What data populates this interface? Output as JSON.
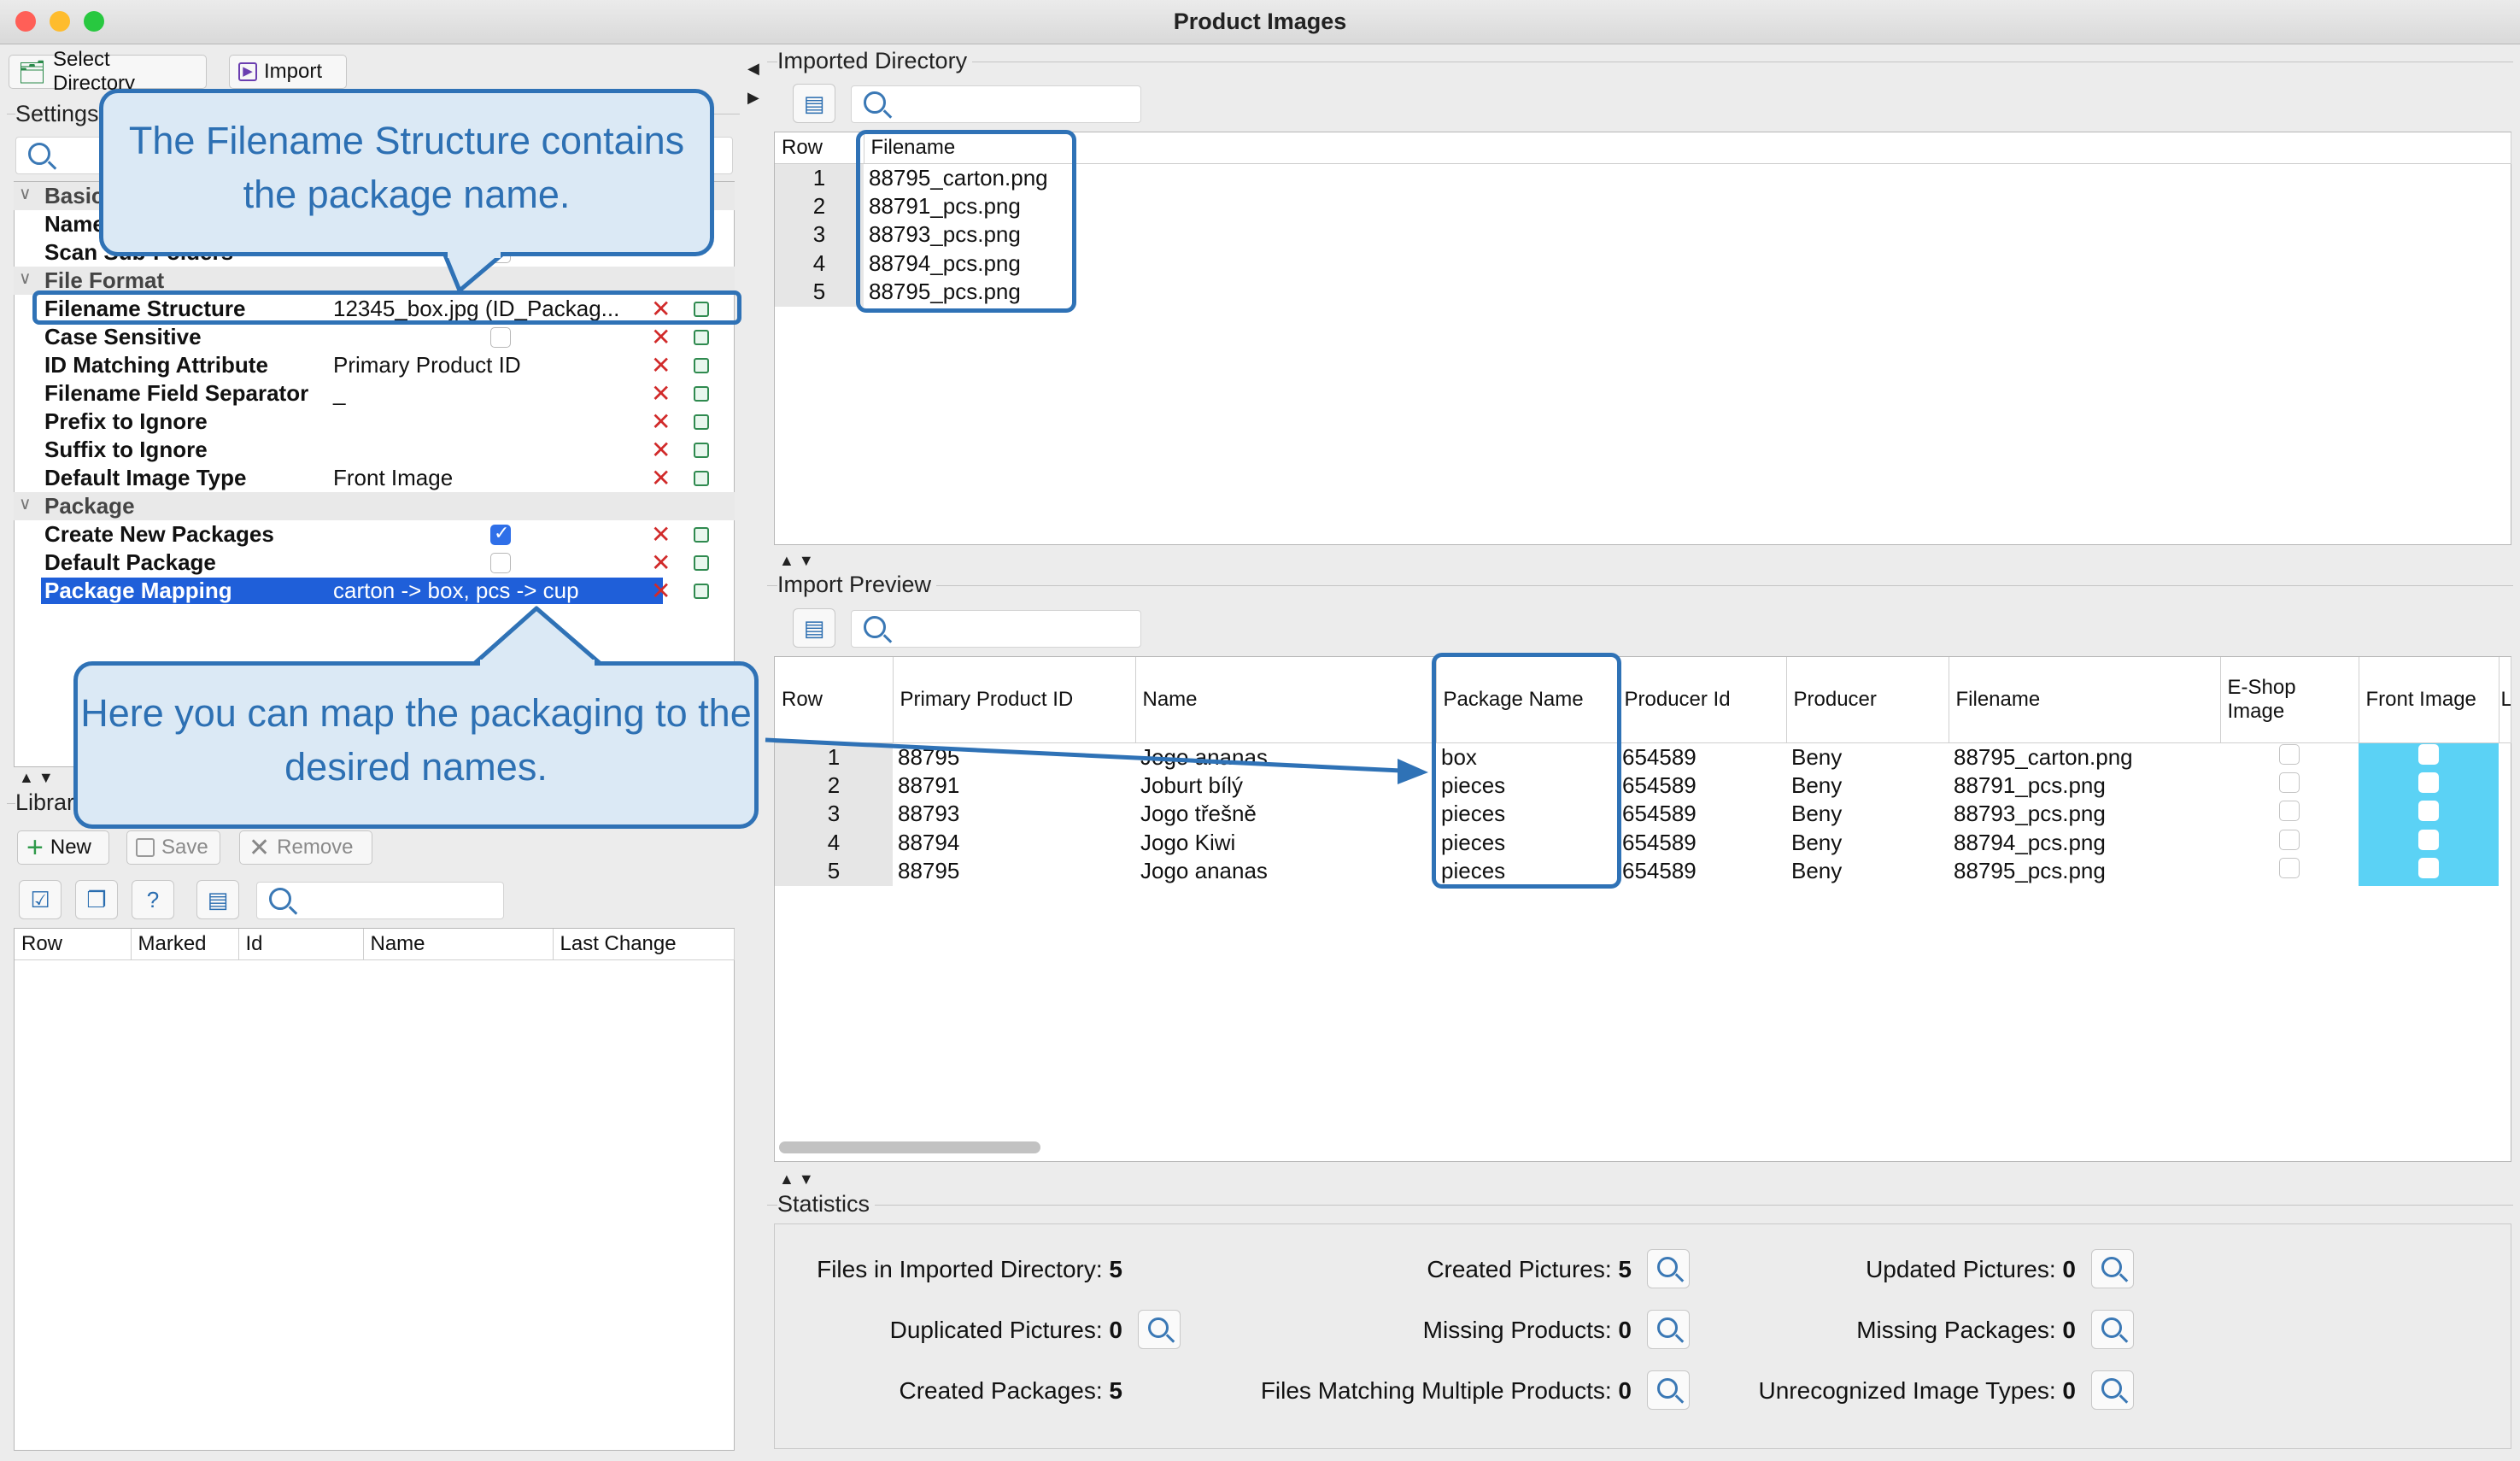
{
  "window": {
    "title": "Product Images"
  },
  "toolbar": {
    "select_directory": "Select Directory",
    "import": "Import"
  },
  "settings": {
    "title": "Settings",
    "groups": {
      "basic": "Basic",
      "file_format": "File Format",
      "package": "Package"
    },
    "rows": {
      "name": "Name",
      "scan_sub_folders": "Scan Sub-Folders",
      "filename_structure": {
        "label": "Filename Structure",
        "value": "12345_box.jpg (ID_Packag..."
      },
      "case_sensitive": {
        "label": "Case Sensitive",
        "checked": false
      },
      "id_matching": {
        "label": "ID Matching Attribute",
        "value": "Primary Product ID"
      },
      "separator": {
        "label": "Filename Field Separator",
        "value": "_"
      },
      "prefix": {
        "label": "Prefix to Ignore",
        "value": ""
      },
      "suffix": {
        "label": "Suffix to Ignore",
        "value": ""
      },
      "default_image_type": {
        "label": "Default Image Type",
        "value": "Front Image"
      },
      "create_new_packages": {
        "label": "Create New Packages",
        "checked": true
      },
      "default_package": {
        "label": "Default Package",
        "checked": false
      },
      "package_mapping": {
        "label": "Package Mapping",
        "value": "carton -> box, pcs -> cup"
      }
    }
  },
  "library": {
    "title": "Library",
    "new": "New",
    "save": "Save",
    "remove": "Remove",
    "columns": [
      "Row",
      "Marked",
      "Id",
      "Name",
      "Last Change"
    ]
  },
  "imported_directory": {
    "title": "Imported Directory",
    "columns": [
      "Row",
      "Filename"
    ],
    "rows": [
      [
        "1",
        "88795_carton.png"
      ],
      [
        "2",
        "88791_pcs.png"
      ],
      [
        "3",
        "88793_pcs.png"
      ],
      [
        "4",
        "88794_pcs.png"
      ],
      [
        "5",
        "88795_pcs.png"
      ]
    ]
  },
  "import_preview": {
    "title": "Import Preview",
    "columns": [
      "Row",
      "Primary Product ID",
      "Name",
      "Package Name",
      "Producer Id",
      "Producer",
      "Filename",
      "E-Shop Image",
      "Front Image",
      "L"
    ],
    "rows": [
      [
        "1",
        "88795",
        "Jogo ananas",
        "box",
        "654589",
        "Beny",
        "88795_carton.png"
      ],
      [
        "2",
        "88791",
        "Joburt bílý",
        "pieces",
        "654589",
        "Beny",
        "88791_pcs.png"
      ],
      [
        "3",
        "88793",
        "Jogo třešně",
        "pieces",
        "654589",
        "Beny",
        "88793_pcs.png"
      ],
      [
        "4",
        "88794",
        "Jogo Kiwi",
        "pieces",
        "654589",
        "Beny",
        "88794_pcs.png"
      ],
      [
        "5",
        "88795",
        "Jogo ananas",
        "pieces",
        "654589",
        "Beny",
        "88795_pcs.png"
      ]
    ]
  },
  "statistics": {
    "title": "Statistics",
    "files_in_dir": {
      "label": "Files in Imported Directory:",
      "value": "5"
    },
    "created_pictures": {
      "label": "Created Pictures:",
      "value": "5"
    },
    "updated_pictures": {
      "label": "Updated Pictures:",
      "value": "0"
    },
    "duplicated_pictures": {
      "label": "Duplicated Pictures:",
      "value": "0"
    },
    "missing_products": {
      "label": "Missing Products:",
      "value": "0"
    },
    "missing_packages": {
      "label": "Missing Packages:",
      "value": "0"
    },
    "created_packages": {
      "label": "Created Packages:",
      "value": "5"
    },
    "files_matching_multiple": {
      "label": "Files Matching Multiple Products:",
      "value": "0"
    },
    "unrecognized_types": {
      "label": "Unrecognized Image Types:",
      "value": "0"
    }
  },
  "callouts": {
    "filename_structure": "The Filename Structure contains the package name.",
    "package_mapping": "Here you can map the packaging to the desired names."
  },
  "colors": {
    "accent": "#2f72b6",
    "selection": "#1f5fd9",
    "cyan": "#5bd2f5",
    "callout_bg": "#dbe9f5"
  }
}
